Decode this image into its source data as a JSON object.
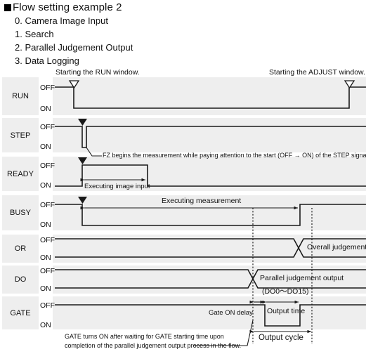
{
  "heading": {
    "title": "Flow setting example 2",
    "items": [
      "0. Camera Image Input",
      "1. Search",
      "2. Parallel Judgement Output",
      "3. Data Logging"
    ]
  },
  "diagram": {
    "level_off": "OFF",
    "level_on": "ON",
    "signals": [
      {
        "name": "RUN",
        "level_off": "OFF",
        "level_on": "ON"
      },
      {
        "name": "STEP",
        "level_off": "OFF",
        "level_on": "ON"
      },
      {
        "name": "READY",
        "level_off": "OFF",
        "level_on": "ON"
      },
      {
        "name": "BUSY",
        "level_off": "OFF",
        "level_on": "ON"
      },
      {
        "name": "OR",
        "level_off": "OFF",
        "level_on": "ON"
      },
      {
        "name": "DO",
        "level_off": "OFF",
        "level_on": "ON"
      },
      {
        "name": "GATE",
        "level_off": "OFF",
        "level_on": "ON"
      }
    ],
    "annotations": {
      "run_start": "Starting the RUN window.",
      "adjust_start": "Starting the ADJUST window.",
      "step_note": "FZ begins the measurement while paying attention to the start (OFF → ON) of the STEP signal.",
      "ready_span": "Executing image input",
      "busy_span": "Executing measurement",
      "or_label": "Overall judgement",
      "do_label": "Parallel judgement output",
      "do_range": "(DO0～DO15)",
      "gate_on_delay": "Gate ON delay",
      "output_time": "Output time",
      "output_cycle": "Output cycle",
      "gate_note_line1": "GATE turns ON after waiting for GATE starting time upon",
      "gate_note_line2": "completion of the parallel judgement output process in the flow."
    }
  },
  "colors": {
    "band": "#eeeeee",
    "stroke": "#1a1a1a",
    "page": "#ffffff"
  }
}
